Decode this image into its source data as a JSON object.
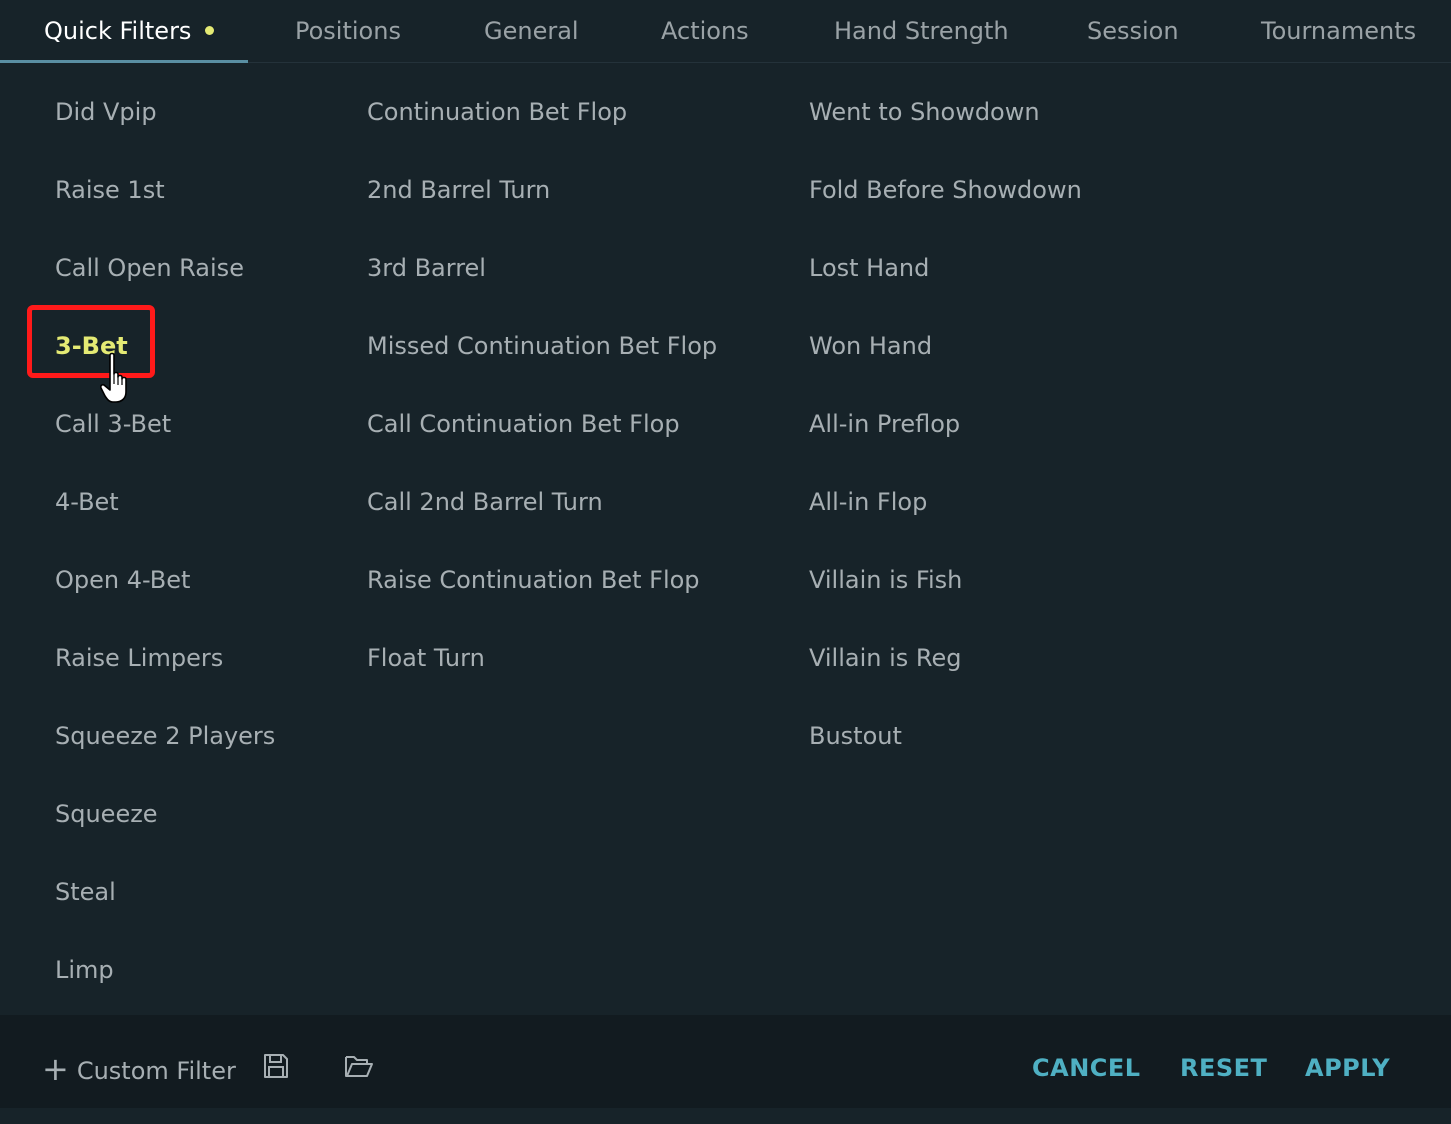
{
  "tabs": [
    {
      "label": "Quick Filters",
      "active": true
    },
    {
      "label": "Positions"
    },
    {
      "label": "General"
    },
    {
      "label": "Actions"
    },
    {
      "label": "Hand Strength"
    },
    {
      "label": "Session"
    },
    {
      "label": "Tournaments"
    }
  ],
  "filters": {
    "col1": [
      "Did Vpip",
      "Raise 1st",
      "Call Open Raise",
      "3-Bet",
      "Call 3-Bet",
      "4-Bet",
      "Open 4-Bet",
      "Raise Limpers",
      "Squeeze 2 Players",
      "Squeeze",
      "Steal",
      "Limp"
    ],
    "col2": [
      "Continuation Bet Flop",
      "2nd Barrel Turn",
      "3rd Barrel",
      "Missed Continuation Bet Flop",
      "Call Continuation Bet Flop",
      "Call 2nd Barrel Turn",
      "Raise Continuation Bet Flop",
      "Float Turn"
    ],
    "col3": [
      "Went to Showdown",
      "Fold Before Showdown",
      "Lost Hand",
      "Won Hand",
      "All-in Preflop",
      "All-in Flop",
      "Villain is Fish",
      "Villain is Reg",
      "Bustout"
    ]
  },
  "selected_filter": "3-Bet",
  "footer": {
    "plus_glyph": "+",
    "custom_filter_label": "Custom Filter",
    "cancel_label": "CANCEL",
    "reset_label": "RESET",
    "apply_label": "APPLY"
  },
  "colors": {
    "background": "#172329",
    "footer_background": "#121b20",
    "accent": "#4fb0c3",
    "selected": "#e4ea74",
    "highlight": "#ff1a1a"
  }
}
